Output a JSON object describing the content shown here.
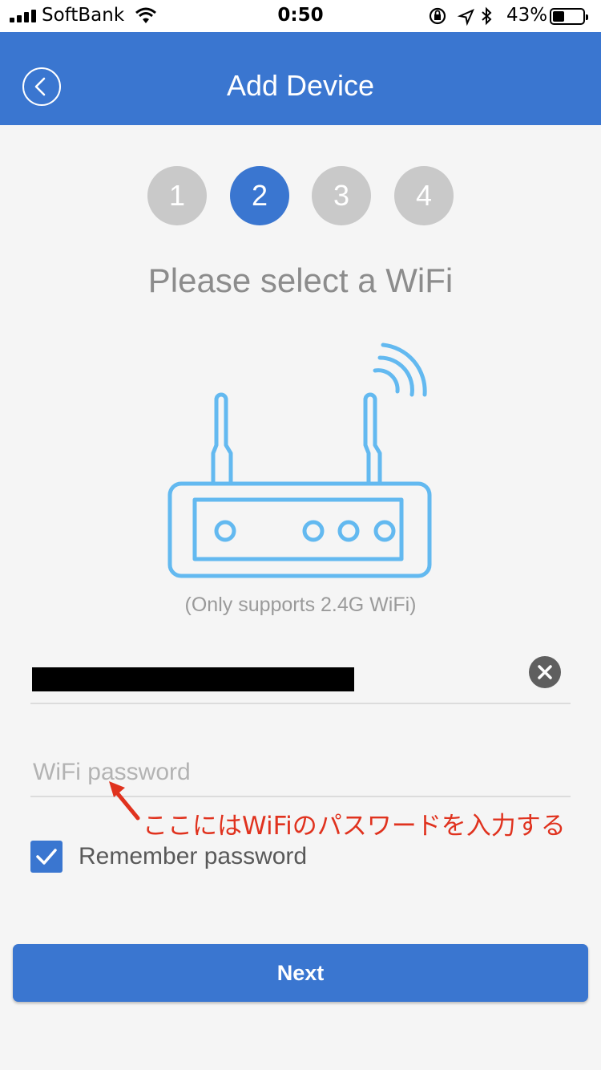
{
  "status_bar": {
    "carrier": "SoftBank",
    "time": "0:50",
    "battery_percent": "43%"
  },
  "navbar": {
    "title": "Add Device",
    "back_icon": "chevron-left-icon"
  },
  "steps": {
    "items": [
      "1",
      "2",
      "3",
      "4"
    ],
    "active_index": 1
  },
  "heading": "Please select a WiFi",
  "illustration": {
    "icon": "router-icon"
  },
  "support_note": "(Only supports 2.4G WiFi)",
  "ssid": {
    "value": "",
    "clear_icon": "clear-icon"
  },
  "password": {
    "value": "",
    "placeholder": "WiFi password"
  },
  "annotation": {
    "text": "ここにはWiFiのパスワードを入力する"
  },
  "remember": {
    "label": "Remember password",
    "checked": true
  },
  "next_button": {
    "label": "Next"
  },
  "colors": {
    "accent": "#3a76d0",
    "step_inactive": "#c9c9c9",
    "annotation": "#e0321e",
    "router_stroke": "#63b9f0"
  }
}
